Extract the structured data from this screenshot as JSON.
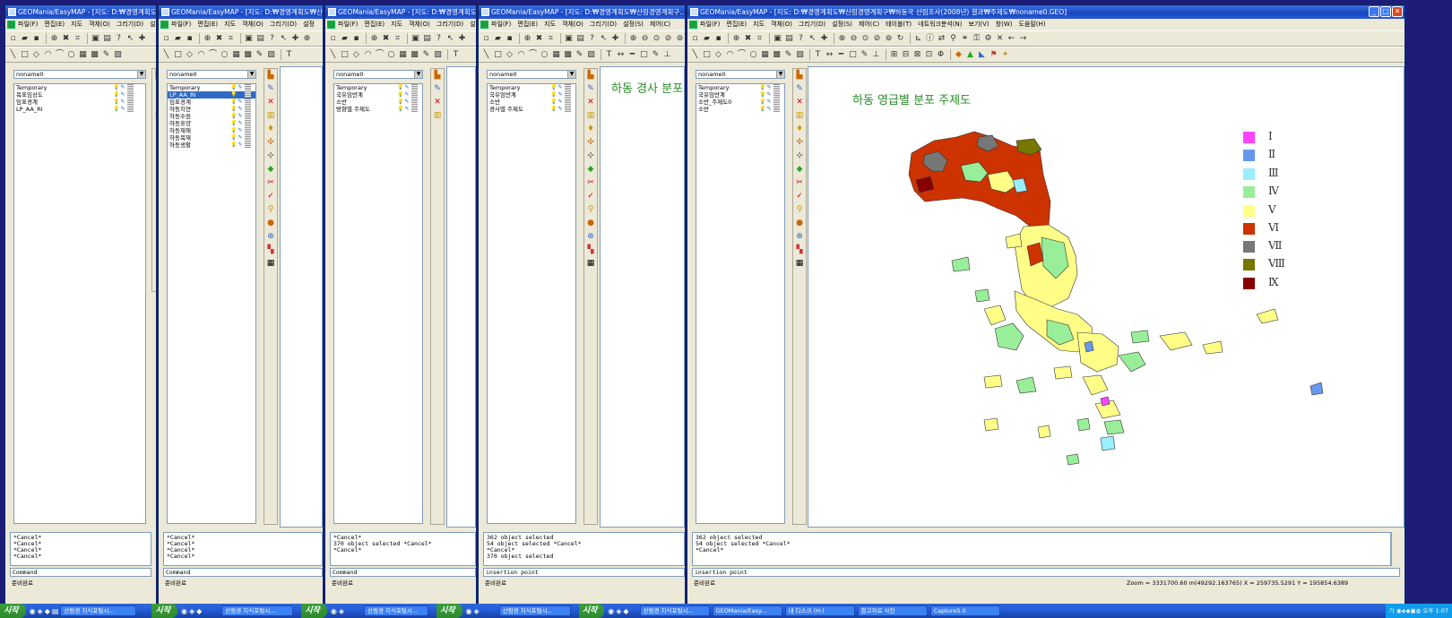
{
  "windows": [
    {
      "title": "GEOMania/EasyMAP - [지도: D:₩경영계획도₩산...",
      "menu": [
        "파일(F)",
        "편집(E)",
        "지도",
        "객체(O)",
        "그리기(D)",
        "설정"
      ],
      "combo": "noname0",
      "layers": [
        "Temporary",
        "목표임상도",
        "임표경계",
        "LP_AA_RI"
      ],
      "selected_layer": -1,
      "cmd_lines": [
        "*Cancel*",
        "*Cancel*",
        "*Cancel*",
        "*Cancel*"
      ],
      "cmd_prompt": "Command",
      "status": "준비완료"
    },
    {
      "title": "GEOMania/EasyMAP - [지도: D:₩경영계획도₩산...",
      "menu": [
        "파일(F)",
        "편집(E)",
        "지도",
        "객체(O)",
        "그리기(D)",
        "설정"
      ],
      "combo": "noname0",
      "layers": [
        "Temporary",
        "LP_AA_RI",
        "임표경계",
        "하동지연",
        "하동수원",
        "하동휴양",
        "하동재해",
        "하동목재",
        "하동생활"
      ],
      "selected_layer": 1,
      "cmd_lines": [
        "*Cancel*",
        "*Cancel*",
        "*Cancel*",
        "*Cancel*"
      ],
      "cmd_prompt": "Command",
      "status": "준비완료"
    },
    {
      "title": "GEOMania/EasyMAP - [지도: D:₩경영계획도₩산...",
      "menu": [
        "파일(F)",
        "편집(E)",
        "지도",
        "객체(O)",
        "그리기(D)",
        "설정"
      ],
      "combo": "noname0",
      "layers": [
        "Temporary",
        "국유임반계",
        "소반",
        "방향별 주제도"
      ],
      "selected_layer": -1,
      "cmd_lines": [
        "*Cancel*",
        "",
        "370 object selected *Cancel*",
        "*Cancel*"
      ],
      "cmd_prompt": "Command",
      "status": "준비완료"
    },
    {
      "title": "GEOMania/EasyMAP - [지도: D:₩경영계획도₩산림경영계획구...",
      "menu": [
        "파일(F)",
        "편집(E)",
        "지도",
        "객체(O)",
        "그리기(D)",
        "설정(S)",
        "제어(C)"
      ],
      "combo": "noname0",
      "layers": [
        "Temporary",
        "국유임반계",
        "소반",
        "경사별 주제도"
      ],
      "selected_layer": -1,
      "cmd_lines": [
        "362 object selected",
        "54 object selected *Cancel*",
        "*Cancel*",
        "",
        "370 object selected"
      ],
      "cmd_prompt": "insertion point",
      "status": "준비완료",
      "map_title": "하동 경사 분포"
    },
    {
      "title": "GEOMania/EasyMAP - [지도: D:₩경영계획도₩산림경영계획구₩하동국 산림조사(2008년) 결과₩주제도₩noname0.GEO]",
      "menu": [
        "파일(F)",
        "편집(E)",
        "지도",
        "객체(O)",
        "그리기(D)",
        "설정(S)",
        "제어(C)",
        "테이블(T)",
        "네트워크분석(N)",
        "보기(V)",
        "창(W)",
        "도움말(H)"
      ],
      "combo": "noname0",
      "layers": [
        "Temporary",
        "국유임반계",
        "소반_주제도0",
        "소반"
      ],
      "selected_layer": -1,
      "cmd_lines": [
        "362 object selected",
        "54 object selected *Cancel*",
        "*Cancel*"
      ],
      "cmd_prompt": "insertion point",
      "status": "준비완료",
      "zoom_readout": "Zoom = 3331700.60 m(49292.163765)  X = 259735.5291        Y = 195854.6389",
      "map_title": "하동 영급별 분포 주제도"
    }
  ],
  "legend": [
    {
      "label": "Ⅰ",
      "color": "#ff44ff"
    },
    {
      "label": "Ⅱ",
      "color": "#6699ee"
    },
    {
      "label": "Ⅲ",
      "color": "#99eeff"
    },
    {
      "label": "Ⅳ",
      "color": "#99ee99"
    },
    {
      "label": "Ⅴ",
      "color": "#ffff88"
    },
    {
      "label": "Ⅵ",
      "color": "#cc3300"
    },
    {
      "label": "Ⅶ",
      "color": "#777777"
    },
    {
      "label": "Ⅷ",
      "color": "#777700"
    },
    {
      "label": "Ⅸ",
      "color": "#880000"
    }
  ],
  "taskbar": {
    "start": "시작",
    "tasks_short": [
      "산림경 지식포털시..."
    ],
    "tasks_main": [
      "산림경 지식포털시...",
      "GEOMania/Easy...",
      "내 디스크 (H:)",
      "참고자료 사진",
      "Capture5.0"
    ],
    "tray_lang": "가",
    "tray_time": "오후 1:07"
  }
}
